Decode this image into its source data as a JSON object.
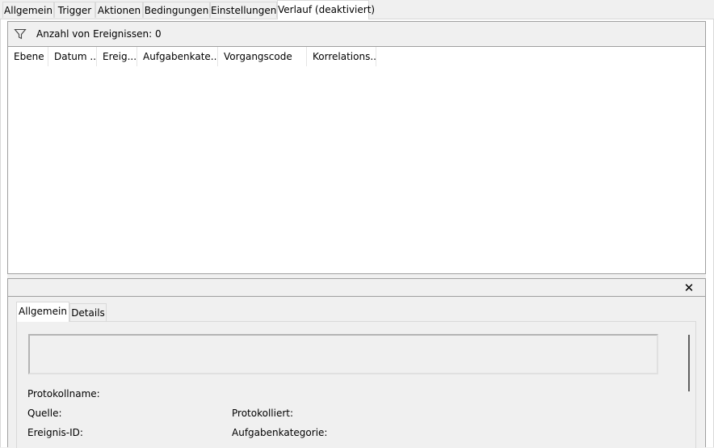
{
  "tabs": [
    {
      "label": "Allgemein"
    },
    {
      "label": "Trigger"
    },
    {
      "label": "Aktionen"
    },
    {
      "label": "Bedingungen"
    },
    {
      "label": "Einstellungen"
    },
    {
      "label": "Verlauf (deaktiviert)",
      "active": true
    }
  ],
  "history": {
    "event_count_label": "Anzahl von Ereignissen: 0",
    "columns": [
      "Ebene",
      "Datum ...",
      "Ereig...",
      "Aufgabenkate...",
      "Vorgangscode",
      "Korrelations..."
    ],
    "rows": []
  },
  "details": {
    "close_label": "✕",
    "tabs": [
      {
        "label": "Allgemein",
        "active": true
      },
      {
        "label": "Details"
      }
    ],
    "fields": {
      "protokollname": "Protokollname:",
      "quelle": "Quelle:",
      "protokolliert": "Protokolliert:",
      "ereignis_id": "Ereignis-ID:",
      "aufgabenkategorie": "Aufgabenkategorie:"
    }
  },
  "icons": {
    "filter": "filter-icon",
    "close": "close-icon"
  }
}
